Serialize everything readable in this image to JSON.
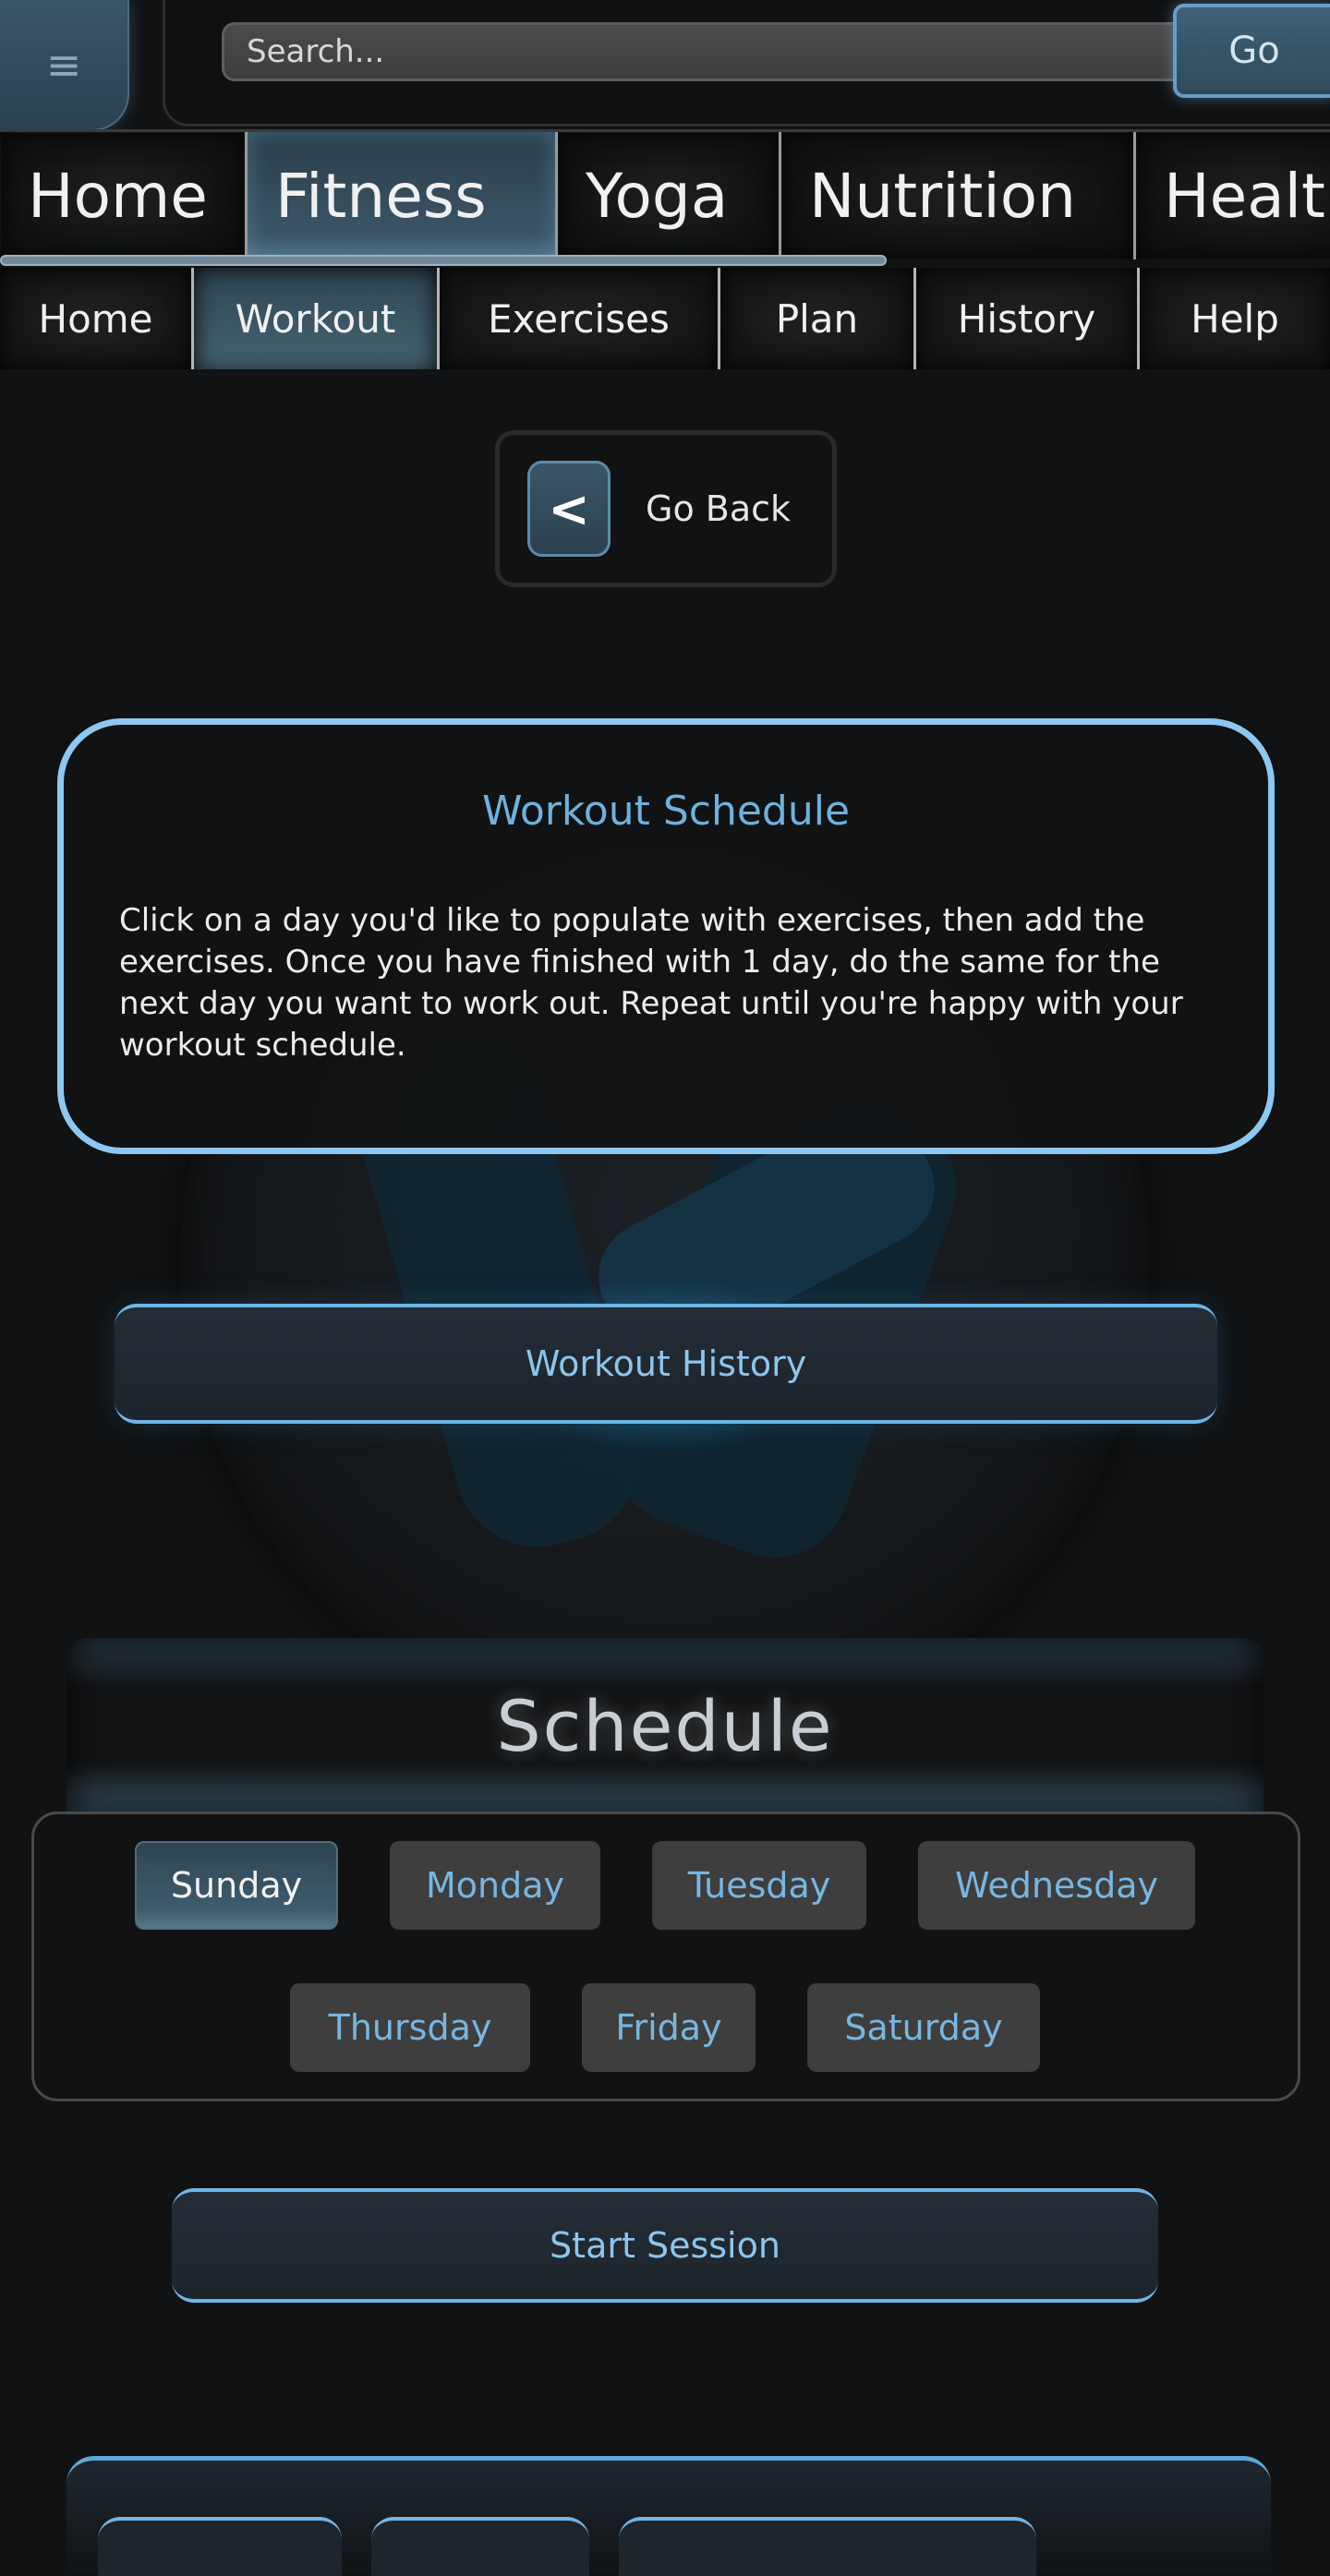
{
  "header": {
    "menu_icon": "hamburger-icon",
    "search_placeholder": "Search...",
    "go_label": "Go"
  },
  "main_nav": {
    "items": [
      {
        "label": "Home"
      },
      {
        "label": "Fitness",
        "active": true
      },
      {
        "label": "Yoga"
      },
      {
        "label": "Nutrition"
      },
      {
        "label": "Healt"
      }
    ]
  },
  "sub_nav": {
    "items": [
      {
        "label": "Home"
      },
      {
        "label": "Workout",
        "active": true
      },
      {
        "label": "Exercises"
      },
      {
        "label": "Plan"
      },
      {
        "label": "History"
      },
      {
        "label": "Help"
      }
    ]
  },
  "go_back": {
    "icon": "<",
    "label": "Go Back"
  },
  "info_card": {
    "title": "Workout Schedule",
    "body": "Click on a day you'd like to populate with exercises, then add the exercises. Once you have finished with 1 day, do the same for the next day you want to work out. Repeat until you're happy with your workout schedule."
  },
  "workout_history_label": "Workout History",
  "schedule": {
    "title": "Schedule",
    "days": [
      {
        "label": "Sunday",
        "active": true
      },
      {
        "label": "Monday"
      },
      {
        "label": "Tuesday"
      },
      {
        "label": "Wednesday"
      },
      {
        "label": "Thursday"
      },
      {
        "label": "Friday"
      },
      {
        "label": "Saturday"
      }
    ]
  },
  "start_session_label": "Start Session",
  "colors": {
    "background": "#111213",
    "accent": "#8ec7f0",
    "accent_text": "#79b6e0",
    "active_tab": "#3b5566"
  }
}
